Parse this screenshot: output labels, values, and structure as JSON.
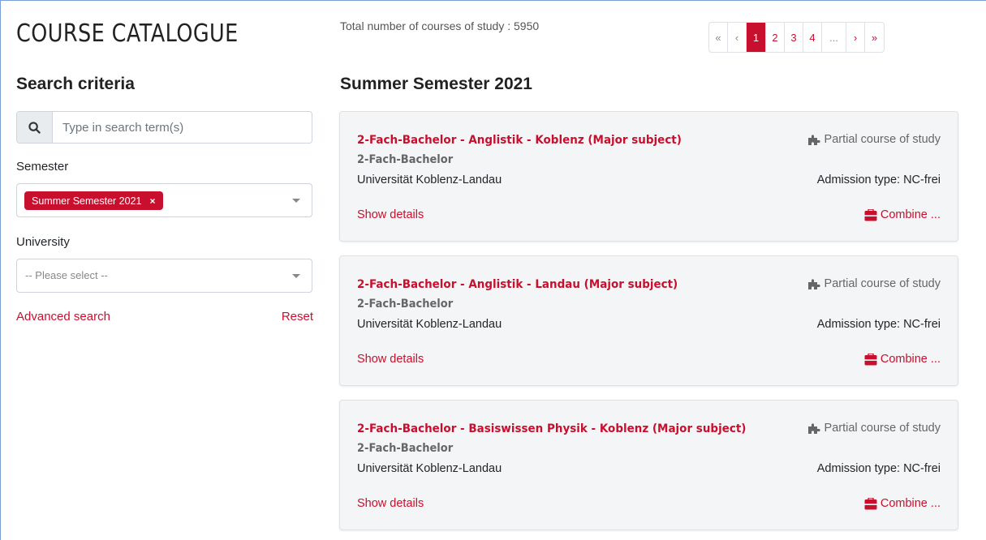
{
  "header": {
    "title": "COURSE CATALOGUE",
    "total_label": "Total number of courses of study : 5950"
  },
  "pagination": {
    "first": "«",
    "prev": "‹",
    "pages": [
      "1",
      "2",
      "3",
      "4"
    ],
    "active_page": "1",
    "ellipsis": "...",
    "next": "›",
    "last": "»"
  },
  "search": {
    "section_title": "Search criteria",
    "placeholder": "Type in search term(s)",
    "semester_label": "Semester",
    "semester_selected": "Summer Semester 2021",
    "semester_remove": "×",
    "university_label": "University",
    "university_placeholder": "-- Please select --",
    "advanced_link": "Advanced search",
    "reset_link": "Reset"
  },
  "results": {
    "title": "Summer Semester 2021",
    "cards": [
      {
        "title": "2-Fach-Bachelor - Anglistik - Koblenz (Major subject)",
        "degree": "2-Fach-Bachelor",
        "university": "Universität Koblenz-Landau",
        "type": "Partial course of study",
        "admission": "Admission type: NC-frei",
        "details_link": "Show details",
        "combine_link": "Combine ..."
      },
      {
        "title": "2-Fach-Bachelor - Anglistik - Landau (Major subject)",
        "degree": "2-Fach-Bachelor",
        "university": "Universität Koblenz-Landau",
        "type": "Partial course of study",
        "admission": "Admission type: NC-frei",
        "details_link": "Show details",
        "combine_link": "Combine ..."
      },
      {
        "title": "2-Fach-Bachelor - Basiswissen Physik - Koblenz (Major subject)",
        "degree": "2-Fach-Bachelor",
        "university": "Universität Koblenz-Landau",
        "type": "Partial course of study",
        "admission": "Admission type: NC-frei",
        "details_link": "Show details",
        "combine_link": "Combine ..."
      }
    ]
  },
  "colors": {
    "accent": "#c8102e",
    "card_bg": "#f4f5f6",
    "muted": "#666666"
  },
  "icons": {
    "search": "search-icon",
    "puzzle": "puzzle-icon",
    "combine": "combine-icon"
  }
}
